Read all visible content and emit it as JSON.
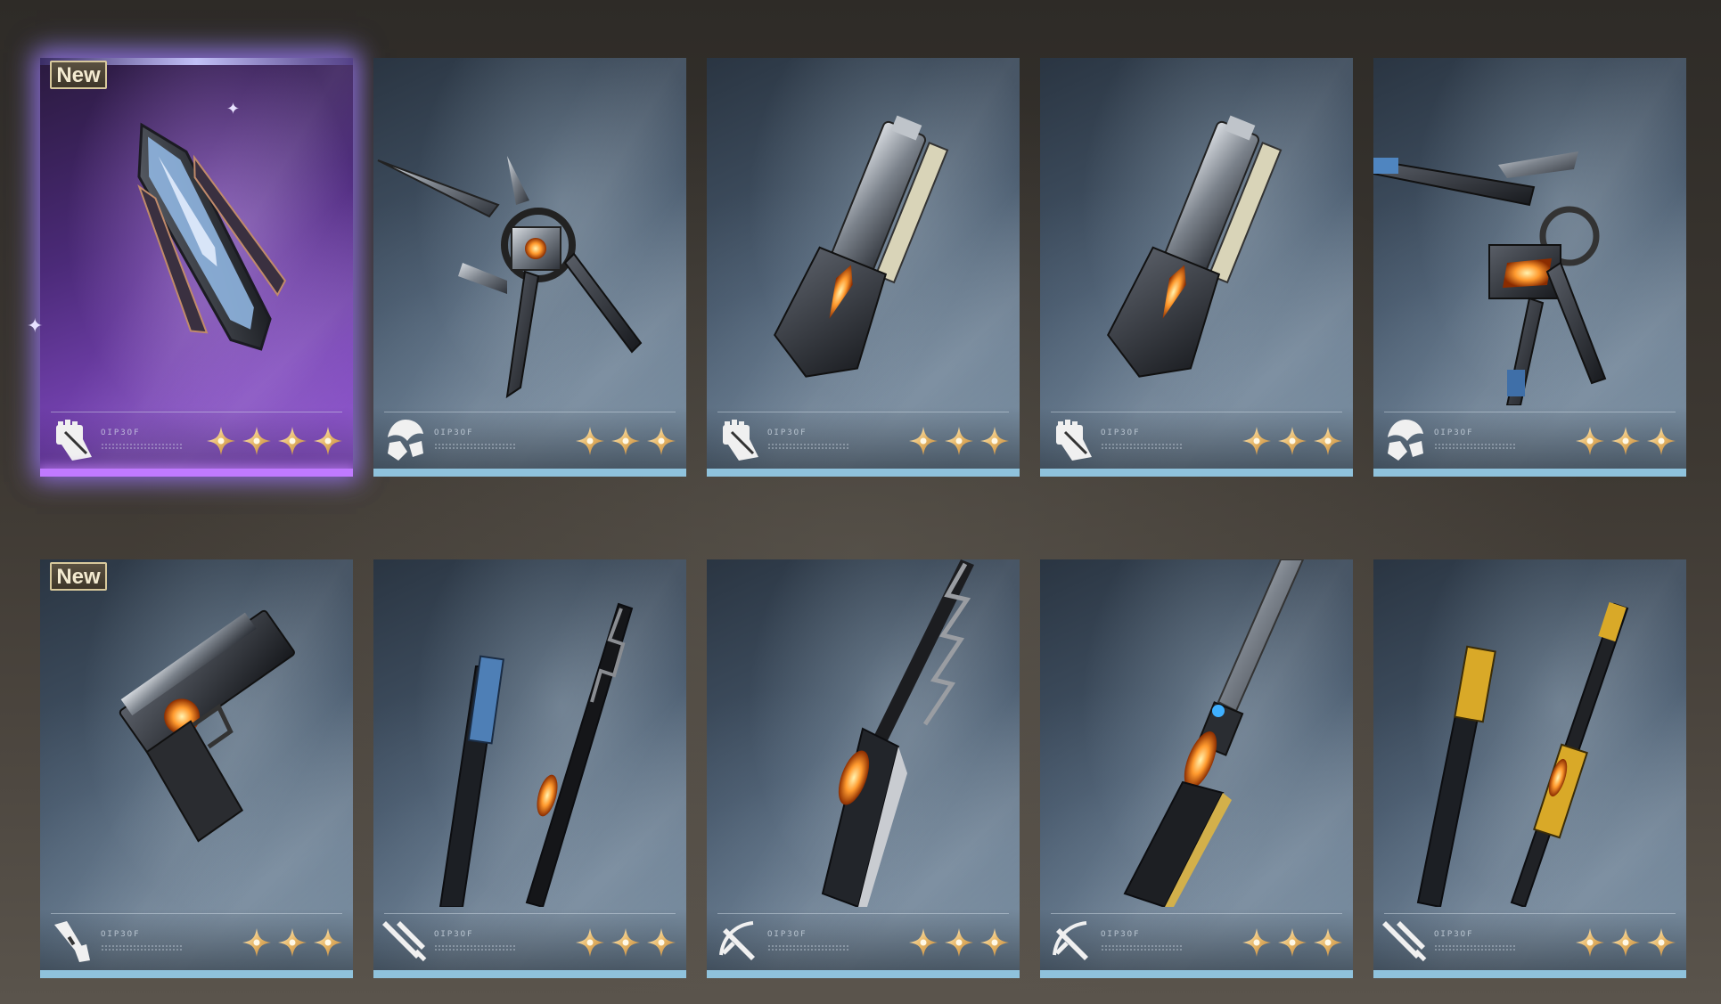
{
  "badges": {
    "new_label": "New"
  },
  "code_label": "OIP3OF",
  "colors": {
    "rare_glow": "#9a63d6",
    "common_bar": "#8fc2dc",
    "star": "#e7b766"
  },
  "cards": [
    {
      "name": "purple-drone-blades",
      "rarity": 4,
      "type_icon": "fist-icon",
      "new": true,
      "rare": true
    },
    {
      "name": "tripod-blade-drone",
      "rarity": 3,
      "type_icon": "shield-icon",
      "new": false
    },
    {
      "name": "gauntlet-weapon-a",
      "rarity": 3,
      "type_icon": "fist-icon",
      "new": false
    },
    {
      "name": "gauntlet-weapon-b",
      "rarity": 3,
      "type_icon": "fist-icon",
      "new": false
    },
    {
      "name": "claw-drone",
      "rarity": 3,
      "type_icon": "shield-icon",
      "new": false
    },
    {
      "name": "pistol",
      "rarity": 3,
      "type_icon": "pistol-icon",
      "new": true
    },
    {
      "name": "dual-blades-blue",
      "rarity": 3,
      "type_icon": "dual-swords-icon",
      "new": false
    },
    {
      "name": "serrated-greatsword",
      "rarity": 3,
      "type_icon": "sword-arc-icon",
      "new": false
    },
    {
      "name": "long-cleaver-sword",
      "rarity": 3,
      "type_icon": "sword-arc-icon",
      "new": false
    },
    {
      "name": "dual-blades-gold",
      "rarity": 3,
      "type_icon": "dual-swords-icon",
      "new": false
    }
  ]
}
